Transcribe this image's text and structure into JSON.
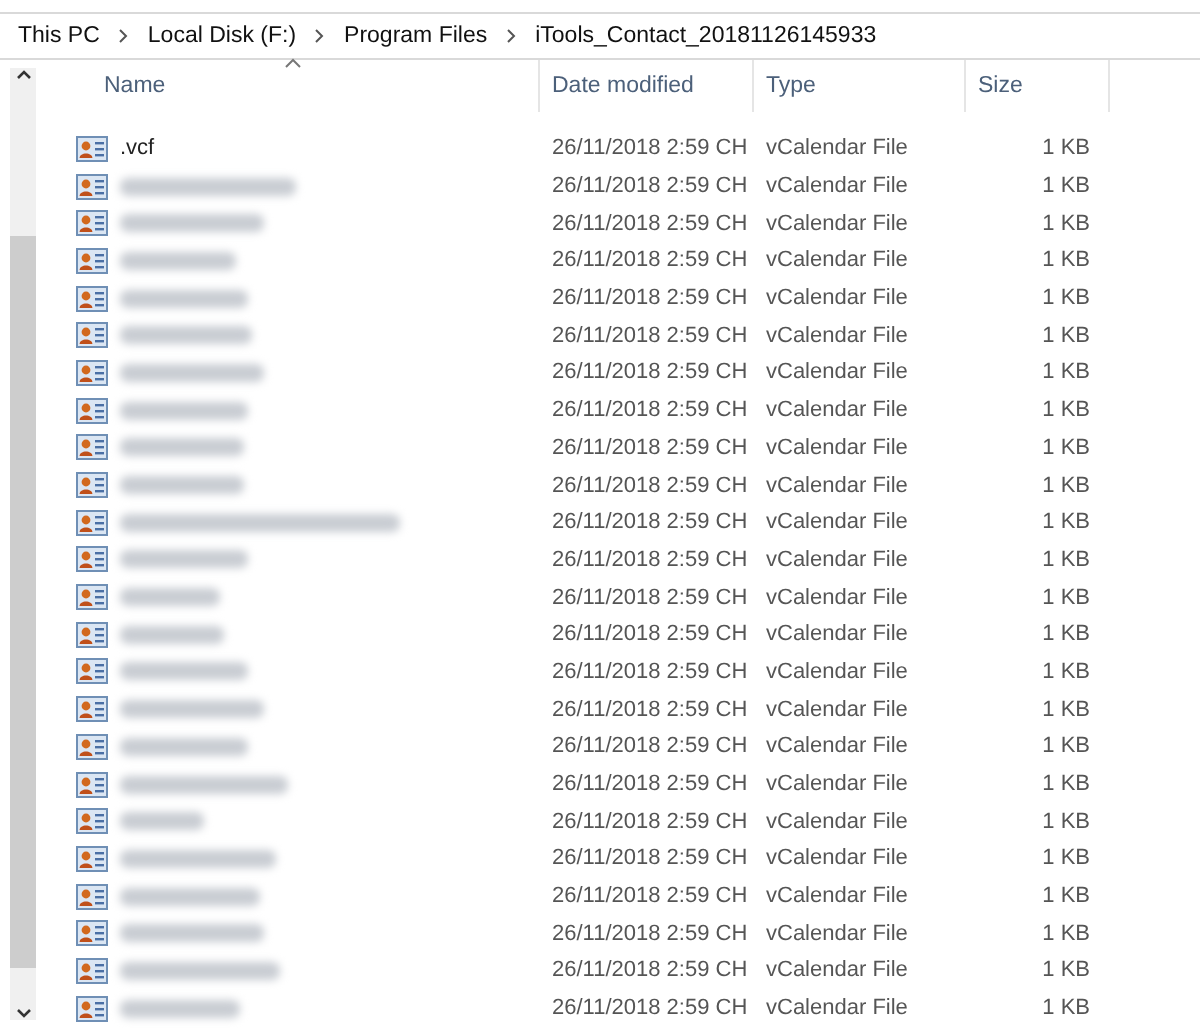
{
  "breadcrumb": [
    "This PC",
    "Local Disk (F:)",
    "Program Files",
    "iTools_Contact_20181126145933"
  ],
  "columns": [
    {
      "label": "Name",
      "sorted": true
    },
    {
      "label": "Date modified",
      "sorted": false
    },
    {
      "label": "Type",
      "sorted": false
    },
    {
      "label": "Size",
      "sorted": false
    }
  ],
  "rows": [
    {
      "name": ".vcf",
      "redacted": false,
      "date": "26/11/2018 2:59 CH",
      "type": "vCalendar File",
      "size": "1 KB"
    },
    {
      "redacted": true,
      "date": "26/11/2018 2:59 CH",
      "type": "vCalendar File",
      "size": "1 KB"
    },
    {
      "redacted": true,
      "date": "26/11/2018 2:59 CH",
      "type": "vCalendar File",
      "size": "1 KB"
    },
    {
      "redacted": true,
      "date": "26/11/2018 2:59 CH",
      "type": "vCalendar File",
      "size": "1 KB"
    },
    {
      "redacted": true,
      "date": "26/11/2018 2:59 CH",
      "type": "vCalendar File",
      "size": "1 KB"
    },
    {
      "redacted": true,
      "date": "26/11/2018 2:59 CH",
      "type": "vCalendar File",
      "size": "1 KB"
    },
    {
      "redacted": true,
      "date": "26/11/2018 2:59 CH",
      "type": "vCalendar File",
      "size": "1 KB"
    },
    {
      "redacted": true,
      "date": "26/11/2018 2:59 CH",
      "type": "vCalendar File",
      "size": "1 KB"
    },
    {
      "redacted": true,
      "date": "26/11/2018 2:59 CH",
      "type": "vCalendar File",
      "size": "1 KB"
    },
    {
      "redacted": true,
      "date": "26/11/2018 2:59 CH",
      "type": "vCalendar File",
      "size": "1 KB"
    },
    {
      "redacted": true,
      "date": "26/11/2018 2:59 CH",
      "type": "vCalendar File",
      "size": "1 KB"
    },
    {
      "redacted": true,
      "date": "26/11/2018 2:59 CH",
      "type": "vCalendar File",
      "size": "1 KB"
    },
    {
      "redacted": true,
      "date": "26/11/2018 2:59 CH",
      "type": "vCalendar File",
      "size": "1 KB"
    },
    {
      "redacted": true,
      "date": "26/11/2018 2:59 CH",
      "type": "vCalendar File",
      "size": "1 KB"
    },
    {
      "redacted": true,
      "date": "26/11/2018 2:59 CH",
      "type": "vCalendar File",
      "size": "1 KB"
    },
    {
      "redacted": true,
      "date": "26/11/2018 2:59 CH",
      "type": "vCalendar File",
      "size": "1 KB"
    },
    {
      "redacted": true,
      "date": "26/11/2018 2:59 CH",
      "type": "vCalendar File",
      "size": "1 KB"
    },
    {
      "redacted": true,
      "date": "26/11/2018 2:59 CH",
      "type": "vCalendar File",
      "size": "1 KB"
    },
    {
      "redacted": true,
      "date": "26/11/2018 2:59 CH",
      "type": "vCalendar File",
      "size": "1 KB"
    },
    {
      "redacted": true,
      "date": "26/11/2018 2:59 CH",
      "type": "vCalendar File",
      "size": "1 KB"
    },
    {
      "redacted": true,
      "date": "26/11/2018 2:59 CH",
      "type": "vCalendar File",
      "size": "1 KB"
    },
    {
      "redacted": true,
      "date": "26/11/2018 2:59 CH",
      "type": "vCalendar File",
      "size": "1 KB"
    },
    {
      "redacted": true,
      "date": "26/11/2018 2:59 CH",
      "type": "vCalendar File",
      "size": "1 KB"
    },
    {
      "redacted": true,
      "date": "26/11/2018 2:59 CH",
      "type": "vCalendar File",
      "size": "1 KB"
    }
  ]
}
